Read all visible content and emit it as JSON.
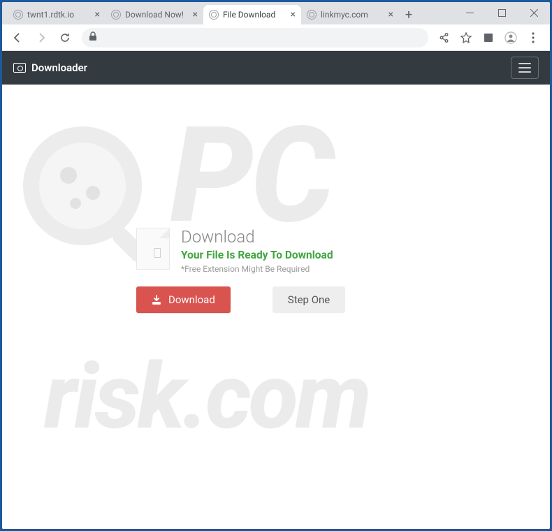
{
  "window": {
    "tabs": [
      {
        "title": "twnt1.rdtk.io"
      },
      {
        "title": "Download Now!"
      },
      {
        "title": "File Download"
      },
      {
        "title": "linkmyc.com"
      }
    ],
    "active_tab_index": 2
  },
  "appbar": {
    "brand": "Downloader"
  },
  "card": {
    "title": "Download",
    "ready": "Your File Is Ready To Download",
    "note": "*Free Extension Might Be Required",
    "download_btn": "Download",
    "step_btn": "Step One"
  },
  "watermark": {
    "top": "PC",
    "bottom": "risk.com"
  }
}
